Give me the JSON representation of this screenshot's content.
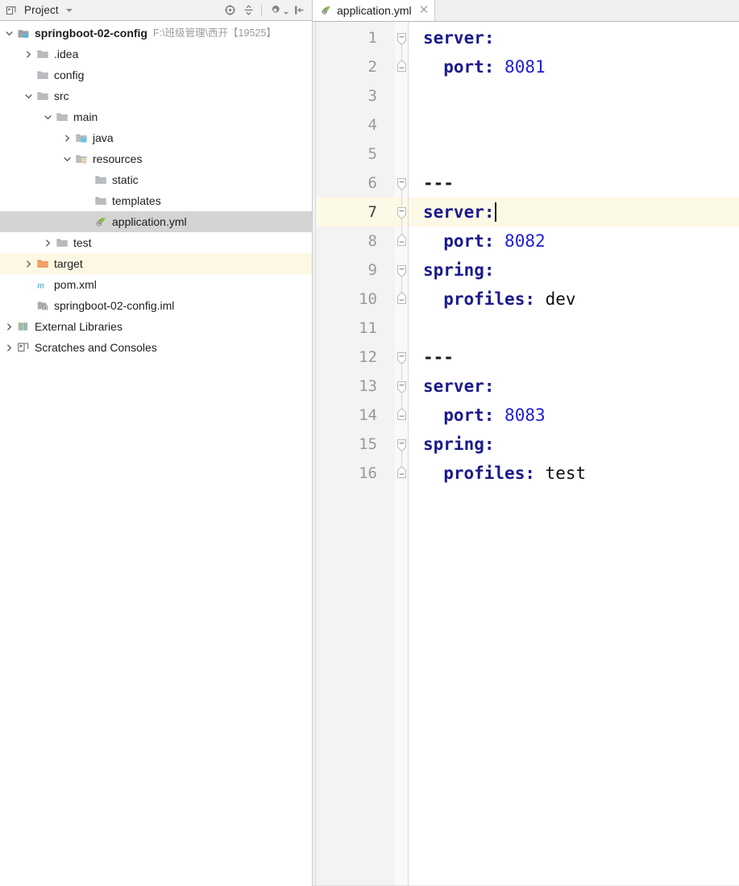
{
  "project_panel": {
    "header": {
      "icon": "project-window-icon",
      "title": "Project",
      "dropdown_icon": "chevron-down-icon",
      "toolbar": [
        {
          "name": "locate-file-icon",
          "tooltip": "Select Opened File"
        },
        {
          "name": "collapse-all-icon",
          "tooltip": "Collapse All"
        },
        {
          "name": "gear-icon",
          "tooltip": "Settings"
        },
        {
          "name": "hide-panel-icon",
          "tooltip": "Hide"
        }
      ]
    },
    "tree": [
      {
        "label": "springboot-02-config",
        "note": "F:\\班级管理\\西开【19525】",
        "icon": "module-icon",
        "depth": 0,
        "arrow": "expanded",
        "bold": true,
        "state": "normal"
      },
      {
        "label": ".idea",
        "note": "",
        "icon": "folder-gray-icon",
        "depth": 1,
        "arrow": "collapsed",
        "bold": false,
        "state": "normal"
      },
      {
        "label": "config",
        "note": "",
        "icon": "folder-gray-icon",
        "depth": 1,
        "arrow": "none",
        "bold": false,
        "state": "normal"
      },
      {
        "label": "src",
        "note": "",
        "icon": "folder-gray-icon",
        "depth": 1,
        "arrow": "expanded",
        "bold": false,
        "state": "normal"
      },
      {
        "label": "main",
        "note": "",
        "icon": "folder-gray-icon",
        "depth": 2,
        "arrow": "expanded",
        "bold": false,
        "state": "normal"
      },
      {
        "label": "java",
        "note": "",
        "icon": "folder-source-icon",
        "depth": 3,
        "arrow": "collapsed",
        "bold": false,
        "state": "normal"
      },
      {
        "label": "resources",
        "note": "",
        "icon": "folder-resources-icon",
        "depth": 3,
        "arrow": "expanded",
        "bold": false,
        "state": "normal"
      },
      {
        "label": "static",
        "note": "",
        "icon": "folder-gray-icon",
        "depth": 4,
        "arrow": "none",
        "bold": false,
        "state": "normal"
      },
      {
        "label": "templates",
        "note": "",
        "icon": "folder-gray-icon",
        "depth": 4,
        "arrow": "none",
        "bold": false,
        "state": "normal"
      },
      {
        "label": "application.yml",
        "note": "",
        "icon": "spring-yaml-icon",
        "depth": 4,
        "arrow": "none",
        "bold": false,
        "state": "selected"
      },
      {
        "label": "test",
        "note": "",
        "icon": "folder-gray-icon",
        "depth": 2,
        "arrow": "collapsed",
        "bold": false,
        "state": "normal"
      },
      {
        "label": "target",
        "note": "",
        "icon": "folder-orange-icon",
        "depth": 1,
        "arrow": "collapsed",
        "bold": false,
        "state": "excluded"
      },
      {
        "label": "pom.xml",
        "note": "",
        "icon": "maven-icon",
        "depth": 1,
        "arrow": "none",
        "bold": false,
        "state": "normal"
      },
      {
        "label": "springboot-02-config.iml",
        "note": "",
        "icon": "iml-icon",
        "depth": 1,
        "arrow": "none",
        "bold": false,
        "state": "normal"
      },
      {
        "label": "External Libraries",
        "note": "",
        "icon": "libraries-icon",
        "depth": 0,
        "arrow": "collapsed",
        "bold": false,
        "state": "normal"
      },
      {
        "label": "Scratches and Consoles",
        "note": "",
        "icon": "scratches-icon",
        "depth": 0,
        "arrow": "collapsed",
        "bold": false,
        "state": "normal"
      }
    ]
  },
  "editor": {
    "tabs": [
      {
        "label": "application.yml",
        "icon": "spring-yaml-icon",
        "close_icon": "close-icon",
        "active": true
      }
    ],
    "caret_line": 7,
    "total_visible_lines": 16,
    "lines": [
      {
        "n": 1,
        "indent": 0,
        "tokens": [
          {
            "t": "server:",
            "c": "k"
          }
        ],
        "fold": "start"
      },
      {
        "n": 2,
        "indent": 2,
        "tokens": [
          {
            "t": "port: ",
            "c": "k"
          },
          {
            "t": "8081",
            "c": "num"
          }
        ],
        "fold": "end"
      },
      {
        "n": 3,
        "indent": 0,
        "tokens": [],
        "fold": "none"
      },
      {
        "n": 4,
        "indent": 0,
        "tokens": [],
        "fold": "none"
      },
      {
        "n": 5,
        "indent": 0,
        "tokens": [],
        "fold": "none"
      },
      {
        "n": 6,
        "indent": 0,
        "tokens": [
          {
            "t": "---",
            "c": "dash"
          }
        ],
        "fold": "start"
      },
      {
        "n": 7,
        "indent": 0,
        "tokens": [
          {
            "t": "server:",
            "c": "k"
          }
        ],
        "fold": "start"
      },
      {
        "n": 8,
        "indent": 2,
        "tokens": [
          {
            "t": "port: ",
            "c": "k"
          },
          {
            "t": "8082",
            "c": "num"
          }
        ],
        "fold": "end"
      },
      {
        "n": 9,
        "indent": 0,
        "tokens": [
          {
            "t": "spring:",
            "c": "k"
          }
        ],
        "fold": "start"
      },
      {
        "n": 10,
        "indent": 2,
        "tokens": [
          {
            "t": "profiles: ",
            "c": "k"
          },
          {
            "t": "dev",
            "c": "val"
          }
        ],
        "fold": "end"
      },
      {
        "n": 11,
        "indent": 0,
        "tokens": [],
        "fold": "none"
      },
      {
        "n": 12,
        "indent": 0,
        "tokens": [
          {
            "t": "---",
            "c": "dash"
          }
        ],
        "fold": "start"
      },
      {
        "n": 13,
        "indent": 0,
        "tokens": [
          {
            "t": "server:",
            "c": "k"
          }
        ],
        "fold": "start"
      },
      {
        "n": 14,
        "indent": 2,
        "tokens": [
          {
            "t": "port: ",
            "c": "k"
          },
          {
            "t": "8083",
            "c": "num"
          }
        ],
        "fold": "end"
      },
      {
        "n": 15,
        "indent": 0,
        "tokens": [
          {
            "t": "spring:",
            "c": "k"
          }
        ],
        "fold": "start"
      },
      {
        "n": 16,
        "indent": 2,
        "tokens": [
          {
            "t": "profiles: ",
            "c": "k"
          },
          {
            "t": "test",
            "c": "val"
          }
        ],
        "fold": "end"
      }
    ]
  },
  "colors": {
    "keyword": "#1a1a8c",
    "number": "#2020d0",
    "value": "#101010",
    "selection": "#d4d4d4",
    "excluded_row": "#fdf8e3",
    "caret_line": "#fdf9e7",
    "gutter": "#f3f3f3",
    "panel_header": "#f2f2f2",
    "tab_bar": "#f0eef0"
  }
}
